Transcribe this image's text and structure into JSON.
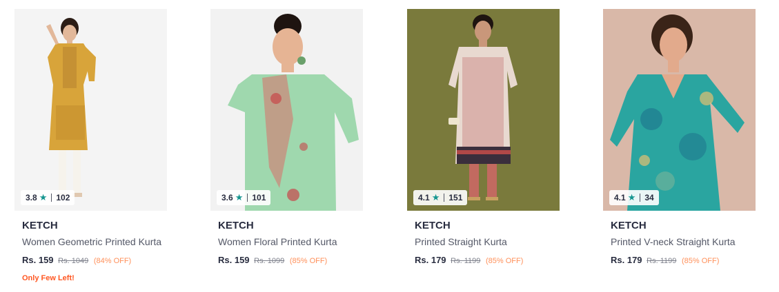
{
  "products": [
    {
      "brand": "KETCH",
      "name": "Women Geometric Printed Kurta",
      "price": "Rs. 159",
      "mrp": "Rs. 1049",
      "discount": "(84% OFF)",
      "rating": "3.8",
      "rating_count": "102",
      "stock_note": "Only Few Left!",
      "image_bg": "#f4f4f4",
      "garment_color": "#d8a43a"
    },
    {
      "brand": "KETCH",
      "name": "Women Floral Printed Kurta",
      "price": "Rs. 159",
      "mrp": "Rs. 1099",
      "discount": "(85% OFF)",
      "rating": "3.6",
      "rating_count": "101",
      "image_bg": "#f2f2f2",
      "garment_color": "#9fd8ae"
    },
    {
      "brand": "KETCH",
      "name": "Printed Straight Kurta",
      "price": "Rs. 179",
      "mrp": "Rs. 1199",
      "discount": "(85% OFF)",
      "rating": "4.1",
      "rating_count": "151",
      "image_bg": "#7a7a3c",
      "garment_color": "#e8d9d0"
    },
    {
      "brand": "KETCH",
      "name": "Printed V-neck Straight Kurta",
      "price": "Rs. 179",
      "mrp": "Rs. 1199",
      "discount": "(85% OFF)",
      "rating": "4.1",
      "rating_count": "34",
      "image_bg": "#d9b8a8",
      "garment_color": "#2aa5a0"
    }
  ],
  "colors": {
    "rating_star": "#14958f",
    "discount": "#ff905a",
    "stock_note": "#ff5722"
  }
}
